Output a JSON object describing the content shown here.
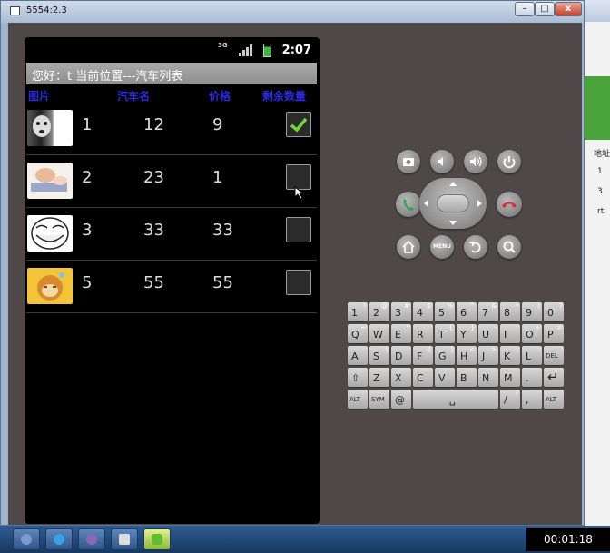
{
  "window": {
    "title": "5554:2.3",
    "min": "–",
    "max": "□",
    "close": "x"
  },
  "status": {
    "network": "3G",
    "time": "2:07"
  },
  "app": {
    "title": "您好：t  当前位置---汽车列表"
  },
  "columns": [
    "图片",
    "汽车名",
    "价格",
    "剩余数量"
  ],
  "rows": [
    {
      "id": "1",
      "name": "12",
      "price": "9",
      "checked": true,
      "image": "husky-dog"
    },
    {
      "id": "2",
      "name": "23",
      "price": "1",
      "checked": false,
      "image": "sleeping-baby"
    },
    {
      "id": "3",
      "name": "33",
      "price": "33",
      "checked": false,
      "image": "troll-face"
    },
    {
      "id": "5",
      "name": "55",
      "price": "55",
      "checked": false,
      "image": "monkey-emoji"
    }
  ],
  "keyboard": {
    "row1": [
      {
        "m": "1",
        "a": "!"
      },
      {
        "m": "2",
        "a": "@"
      },
      {
        "m": "3",
        "a": "#"
      },
      {
        "m": "4",
        "a": "$"
      },
      {
        "m": "5",
        "a": "%"
      },
      {
        "m": "6",
        "a": "^"
      },
      {
        "m": "7",
        "a": "&"
      },
      {
        "m": "8",
        "a": "*"
      },
      {
        "m": "9",
        "a": "("
      },
      {
        "m": "0",
        "a": ")"
      }
    ],
    "row2": [
      {
        "m": "Q",
        "a": "~"
      },
      {
        "m": "W",
        "a": ""
      },
      {
        "m": "E",
        "a": "\""
      },
      {
        "m": "R",
        "a": ""
      },
      {
        "m": "T",
        "a": "{"
      },
      {
        "m": "Y",
        "a": "}"
      },
      {
        "m": "U",
        "a": "-"
      },
      {
        "m": "I",
        "a": ""
      },
      {
        "m": "O",
        "a": "+"
      },
      {
        "m": "P",
        "a": "="
      }
    ],
    "row3": [
      {
        "m": "A",
        "a": ""
      },
      {
        "m": "S",
        "a": "\\"
      },
      {
        "m": "D",
        "a": ""
      },
      {
        "m": "F",
        "a": "["
      },
      {
        "m": "G",
        "a": "]"
      },
      {
        "m": "H",
        "a": "<"
      },
      {
        "m": "J",
        "a": ">"
      },
      {
        "m": "K",
        "a": ";"
      },
      {
        "m": "L",
        "a": ":"
      },
      {
        "m": "DEL",
        "a": ""
      }
    ],
    "row4": [
      {
        "m": "⇧",
        "a": ""
      },
      {
        "m": "Z",
        "a": ""
      },
      {
        "m": "X",
        "a": ""
      },
      {
        "m": "C",
        "a": ""
      },
      {
        "m": "V",
        "a": ""
      },
      {
        "m": "B",
        "a": ""
      },
      {
        "m": "N",
        "a": ""
      },
      {
        "m": "M",
        "a": ""
      },
      {
        "m": ".",
        "a": ""
      },
      {
        "m": "↵",
        "a": ""
      }
    ],
    "row5": [
      {
        "m": "ALT",
        "a": ""
      },
      {
        "m": "SYM",
        "a": ""
      },
      {
        "m": "@",
        "a": ""
      },
      {
        "m": "␣",
        "a": ""
      },
      {
        "m": "/",
        "a": "?"
      },
      {
        "m": ",",
        "a": ""
      },
      {
        "m": "ALT",
        "a": ""
      }
    ]
  },
  "controls": {
    "menu_label": "MENU"
  },
  "right_pane": {
    "label": "地址",
    "r1": "1",
    "r2": "3",
    "r3": "rt"
  },
  "clock": "00:01:18"
}
